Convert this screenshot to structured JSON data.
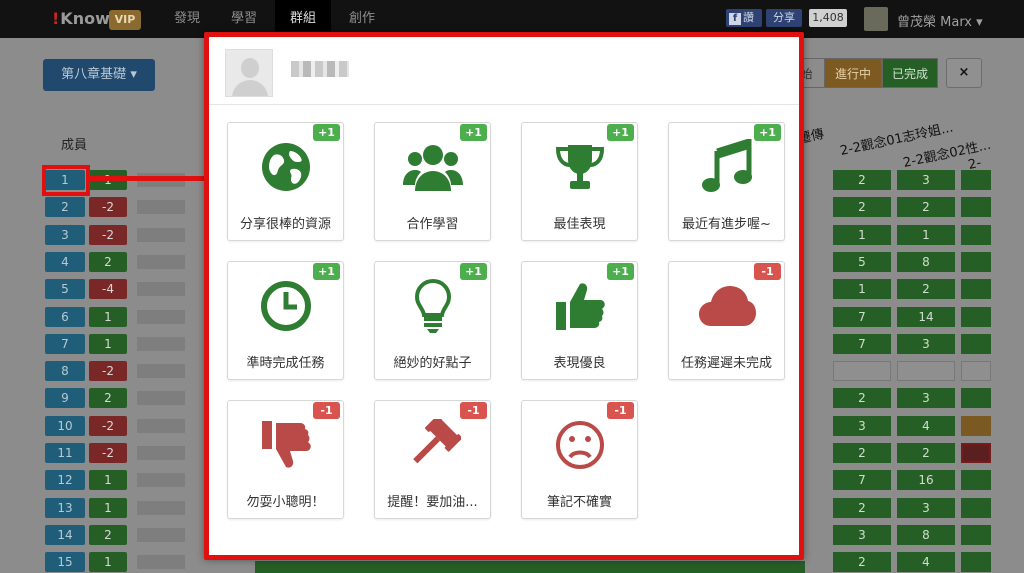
{
  "navbar": {
    "logo": "Know",
    "vip": "VIP",
    "items": [
      "發現",
      "學習",
      "群組",
      "創作"
    ],
    "fb_label": "讚",
    "share_label": "分享",
    "share_count": "1,408",
    "user_name": "曾茂榮 Marx"
  },
  "page": {
    "chapter_button": "第八章基礎",
    "members_label": "成員",
    "status_start": "始",
    "status_in_progress": "進行中",
    "status_done": "已完成",
    "close_label": "×",
    "col_head_1": "2-2觀念01志玲姐...",
    "col_head_2": "2-2觀念02性...",
    "col_head_0": "遷傳",
    "col_head_3": "2-"
  },
  "members": [
    {
      "num": "1",
      "score": "1",
      "c1": "2",
      "c2": "3"
    },
    {
      "num": "2",
      "score": "-2",
      "c1": "2",
      "c2": "2"
    },
    {
      "num": "3",
      "score": "-2",
      "c1": "1",
      "c2": "1"
    },
    {
      "num": "4",
      "score": "2",
      "c1": "5",
      "c2": "8"
    },
    {
      "num": "5",
      "score": "-4",
      "c1": "1",
      "c2": "2"
    },
    {
      "num": "6",
      "score": "1",
      "c1": "7",
      "c2": "14"
    },
    {
      "num": "7",
      "score": "1",
      "c1": "7",
      "c2": "3"
    },
    {
      "num": "8",
      "score": "-2",
      "c1": "",
      "c2": ""
    },
    {
      "num": "9",
      "score": "2",
      "c1": "2",
      "c2": "3"
    },
    {
      "num": "10",
      "score": "-2",
      "c1": "3",
      "c2": "4"
    },
    {
      "num": "11",
      "score": "-2",
      "c1": "2",
      "c2": "2"
    },
    {
      "num": "12",
      "score": "1",
      "c1": "7",
      "c2": "16"
    },
    {
      "num": "13",
      "score": "1",
      "c1": "2",
      "c2": "3"
    },
    {
      "num": "14",
      "score": "2",
      "c1": "3",
      "c2": "8"
    },
    {
      "num": "15",
      "score": "1",
      "c1": "2",
      "c2": "4"
    }
  ],
  "modal": {
    "cards": [
      {
        "label": "分享很棒的資源",
        "badge": "+1",
        "icon": "globe-icon"
      },
      {
        "label": "合作學習",
        "badge": "+1",
        "icon": "group-icon"
      },
      {
        "label": "最佳表現",
        "badge": "+1",
        "icon": "trophy-icon"
      },
      {
        "label": "最近有進步喔~",
        "badge": "+1",
        "icon": "music-note-icon"
      },
      {
        "label": "準時完成任務",
        "badge": "+1",
        "icon": "clock-icon"
      },
      {
        "label": "絕妙的好點子",
        "badge": "+1",
        "icon": "lightbulb-icon"
      },
      {
        "label": "表現優良",
        "badge": "+1",
        "icon": "thumbs-up-icon"
      },
      {
        "label": "任務遲遲未完成",
        "badge": "-1",
        "icon": "cloud-icon"
      },
      {
        "label": "勿耍小聰明！",
        "badge": "-1",
        "icon": "thumbs-down-icon"
      },
      {
        "label": "提醒！要加油...",
        "badge": "-1",
        "icon": "gavel-icon"
      },
      {
        "label": "筆記不確實",
        "badge": "-1",
        "icon": "frown-icon"
      }
    ]
  },
  "colors": {
    "positive": "#2e7d32",
    "negative": "#b94a48",
    "highlight": "#e01010"
  }
}
